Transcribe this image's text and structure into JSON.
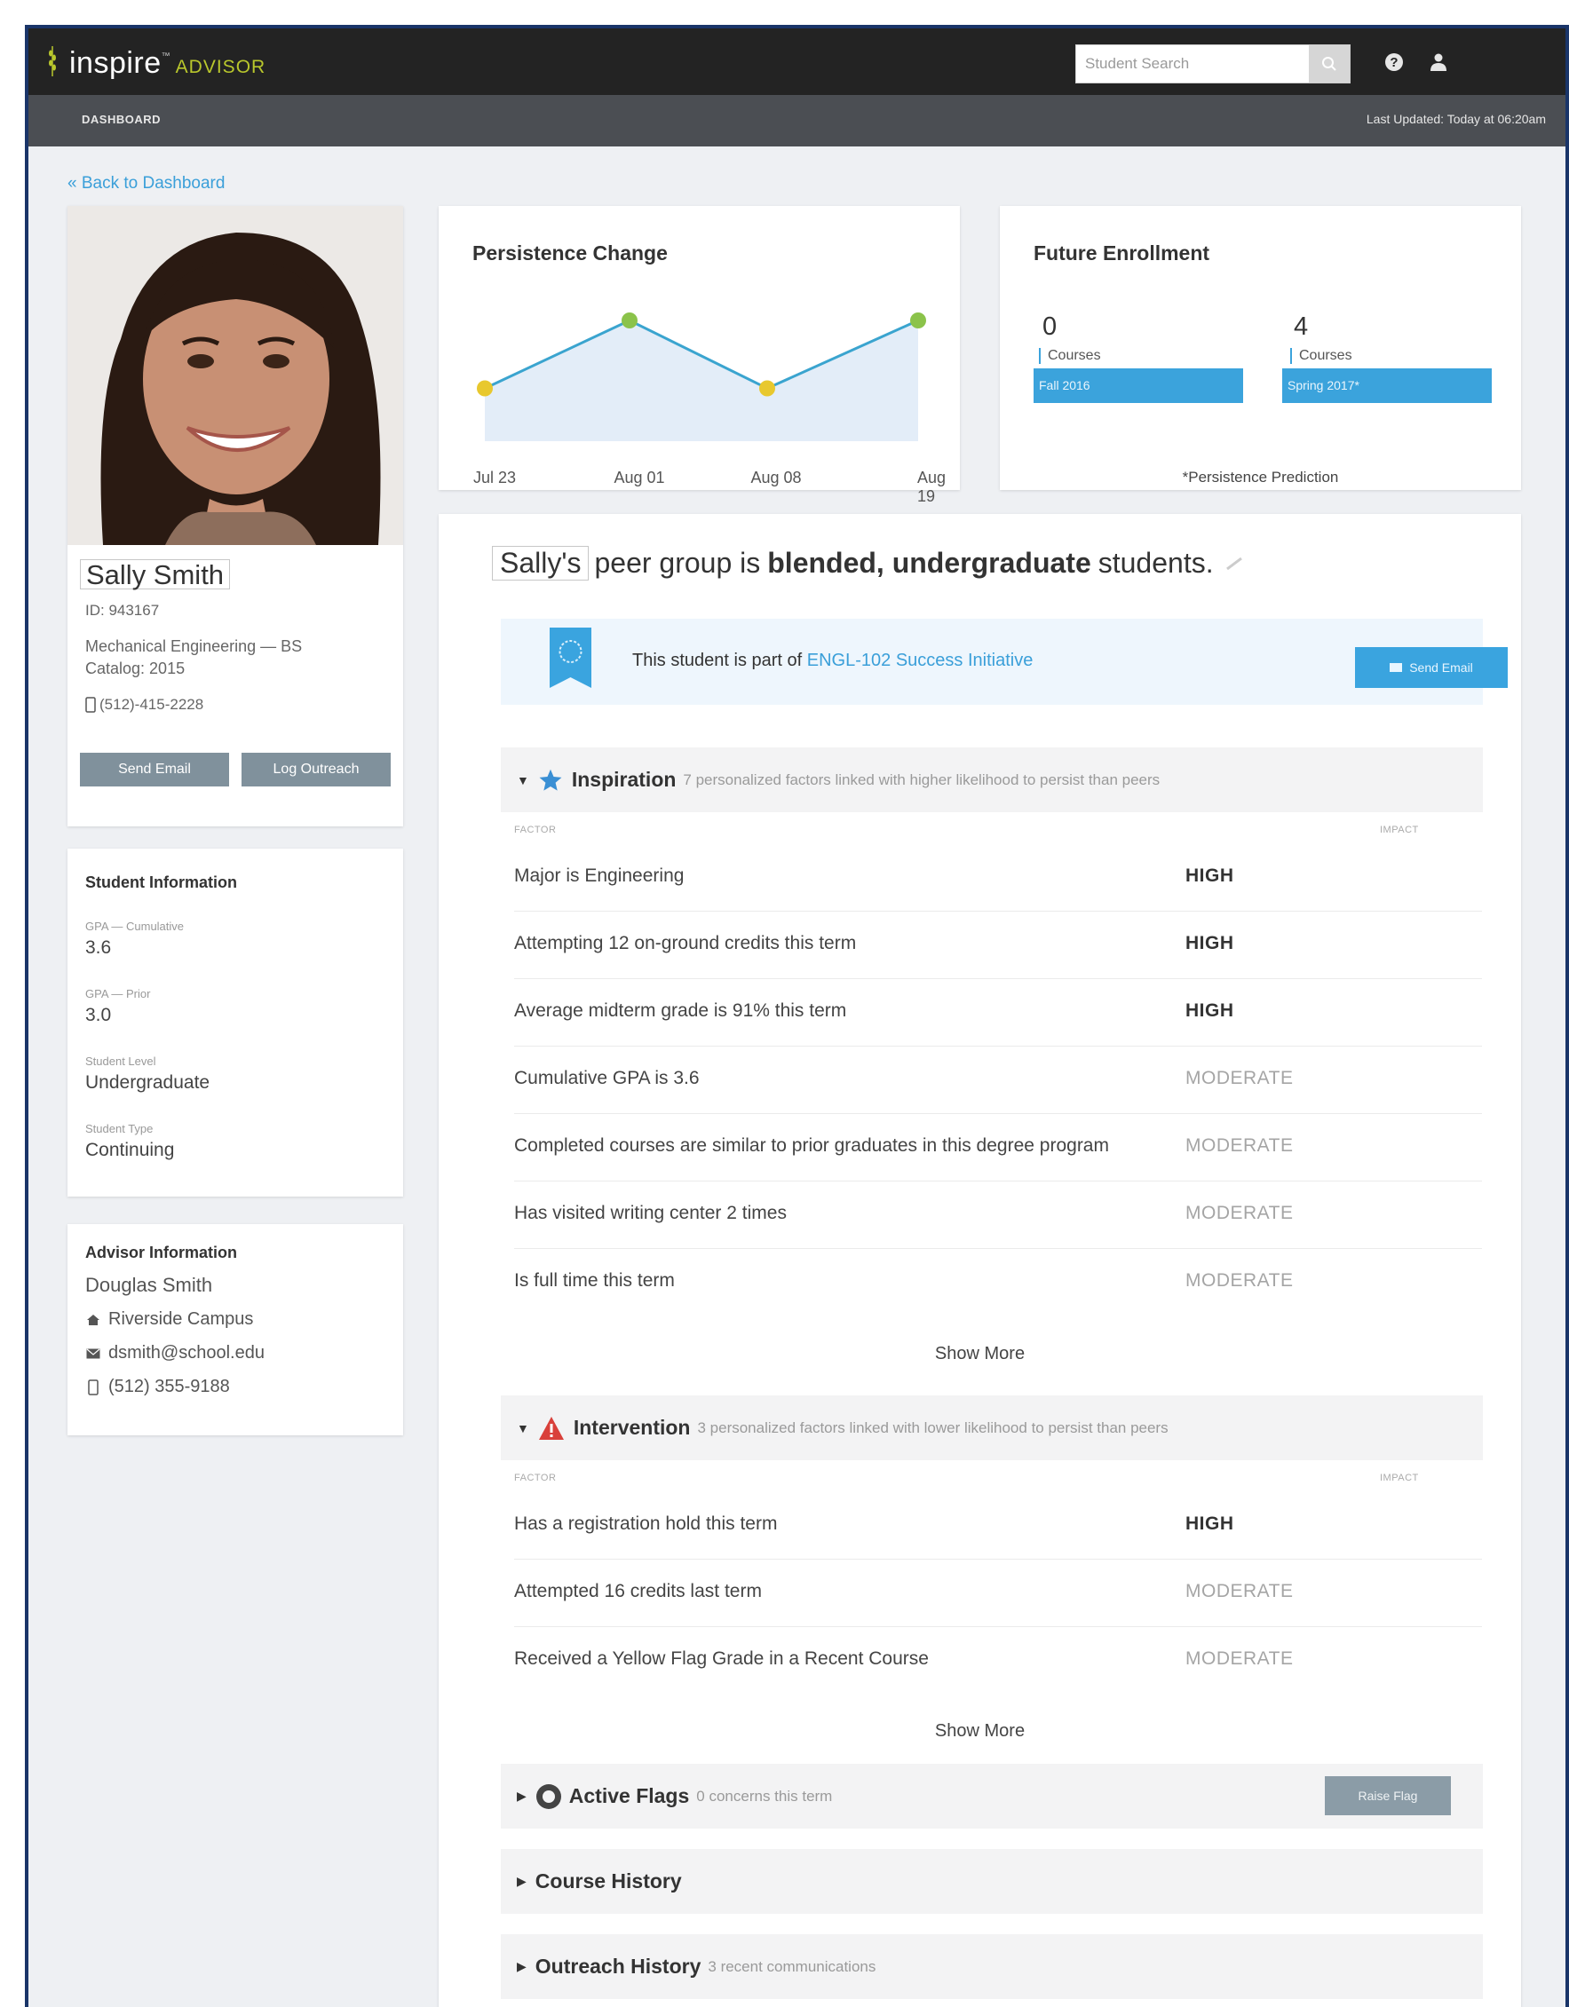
{
  "app": {
    "logo_main": "inspire",
    "logo_tm": "™",
    "logo_sub": "ADVISOR",
    "search_placeholder": "Student Search"
  },
  "subbar": {
    "crumb": "DASHBOARD",
    "last_updated": "Last Updated: Today at 06:20am"
  },
  "nav": {
    "back_link": "« Back to Dashboard"
  },
  "student": {
    "name": "Sally Smith",
    "id": "ID: 943167",
    "program": "Mechanical Engineering — BS",
    "catalog": "Catalog: 2015",
    "phone": "(512)-415-2228",
    "send_email": "Send Email",
    "log_outreach": "Log Outreach"
  },
  "student_info": {
    "title": "Student Information",
    "fields": [
      {
        "label": "GPA — Cumulative",
        "value": "3.6"
      },
      {
        "label": "GPA — Prior",
        "value": "3.0"
      },
      {
        "label": "Student Level",
        "value": "Undergraduate"
      },
      {
        "label": "Student Type",
        "value": "Continuing"
      }
    ]
  },
  "advisor": {
    "title": "Advisor Information",
    "name": "Douglas Smith",
    "campus": "Riverside Campus",
    "email": "dsmith@school.edu",
    "phone": "(512) 355-9188"
  },
  "persistence": {
    "title": "Persistence Change",
    "ticks": [
      "Jul 23",
      "Aug 01",
      "Aug 08",
      "Aug 19"
    ]
  },
  "chart_data": {
    "type": "line",
    "title": "Persistence Change",
    "x": [
      "Jul 23",
      "Aug 01",
      "Aug 08",
      "Aug 19"
    ],
    "series": [
      {
        "values": [
          0.35,
          0.8,
          0.35,
          0.8
        ],
        "point_colors": [
          "#e8c82e",
          "#8bc34a",
          "#e8c82e",
          "#8bc34a"
        ]
      }
    ],
    "ylim": [
      0,
      1
    ],
    "grid": false,
    "line_color": "#3aa4cf",
    "fill_color": "#e3edf8"
  },
  "future": {
    "title": "Future Enrollment",
    "terms": [
      {
        "count": "0",
        "label": "Courses",
        "term": "Fall 2016"
      },
      {
        "count": "4",
        "label": "Courses",
        "term": "Spring 2017*"
      }
    ],
    "note": "*Persistence Prediction"
  },
  "peer": {
    "name": "Sally's",
    "pre": "peer group is",
    "bold": "blended, undergraduate",
    "post": "students."
  },
  "initiative": {
    "text": "This student is part of ",
    "link": "ENGL-102 Success Initiative",
    "button": "Send Email"
  },
  "inspiration": {
    "title": "Inspiration",
    "subtitle": "7 personalized factors linked with higher likelihood to persist than peers",
    "col_factor": "FACTOR",
    "col_impact": "IMPACT",
    "rows": [
      {
        "factor": "Major is Engineering",
        "impact": "HIGH"
      },
      {
        "factor": "Attempting 12 on-ground credits this term",
        "impact": "HIGH"
      },
      {
        "factor": "Average midterm grade is 91% this term",
        "impact": "HIGH"
      },
      {
        "factor": "Cumulative GPA is 3.6",
        "impact": "MODERATE"
      },
      {
        "factor": "Completed courses are similar to prior graduates in this degree program",
        "impact": "MODERATE"
      },
      {
        "factor": "Has visited writing center 2 times",
        "impact": "MODERATE"
      },
      {
        "factor": "Is full time this term",
        "impact": "MODERATE"
      }
    ],
    "show_more": "Show More"
  },
  "intervention": {
    "title": "Intervention",
    "subtitle": "3 personalized factors linked with lower likelihood to persist than peers",
    "col_factor": "FACTOR",
    "col_impact": "IMPACT",
    "rows": [
      {
        "factor": "Has a registration hold this term",
        "impact": "HIGH"
      },
      {
        "factor": "Attempted 16 credits last term",
        "impact": "MODERATE"
      },
      {
        "factor": "Received a Yellow Flag Grade in a Recent Course",
        "impact": "MODERATE"
      }
    ],
    "show_more": "Show More"
  },
  "flags": {
    "title": "Active Flags",
    "subtitle": "0 concerns this term",
    "button": "Raise Flag"
  },
  "course_history": {
    "title": "Course History"
  },
  "outreach": {
    "title": "Outreach History",
    "subtitle": "3 recent communications"
  },
  "colors": {
    "accent": "#3aa4df",
    "topbar": "#232323",
    "subbar": "#4b4e53",
    "brand_green": "#b9c72c"
  }
}
